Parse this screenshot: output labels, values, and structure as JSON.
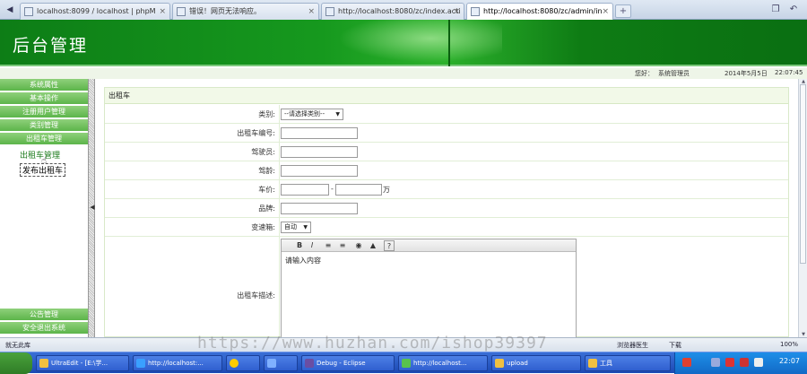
{
  "browser": {
    "tabs": [
      {
        "label": "localhost:8099 / localhost | phpM",
        "active": false
      },
      {
        "label": "错误！网页无法响应。",
        "active": false
      },
      {
        "label": "http://localhost:8080/zc/index.acti",
        "active": false
      },
      {
        "label": "http://localhost:8080/zc/admin/in",
        "active": true
      }
    ],
    "new_tab": "+",
    "close_glyph": "×"
  },
  "header": {
    "title": "后台管理"
  },
  "status_line": {
    "greeting": "您好：",
    "user": "系统管理员",
    "date": "2014年5月5日",
    "time": "22:07:45"
  },
  "sidebar": {
    "menus": [
      {
        "label": "系统属性"
      },
      {
        "label": "基本操作"
      },
      {
        "label": "注册用户管理"
      },
      {
        "label": "类别管理"
      },
      {
        "label": "出租车管理"
      }
    ],
    "submenus": [
      {
        "label": "出租车管理"
      },
      {
        "label": "发布出租车"
      }
    ],
    "bottom_menus": [
      {
        "label": "公告管理"
      },
      {
        "label": "安全退出系统"
      }
    ]
  },
  "form": {
    "caption": "出租车",
    "category_label": "类别:",
    "category_select": "--请选择类别--",
    "number_label": "出租车编号:",
    "driver_label": "驾驶员:",
    "age_label": "驾龄:",
    "price_label": "车价:",
    "price_sep": "-",
    "price_unit": "万",
    "brand_label": "品牌:",
    "transmission_label": "变速箱:",
    "transmission_select": "自动",
    "desc_label": "出租车描述:",
    "editor_placeholder": "请输入内容",
    "toolbar": [
      "B",
      "I",
      "≡",
      "≡",
      "◉",
      "▲",
      "?"
    ]
  },
  "browser_status": {
    "left": "就无此库",
    "zoom": "100%",
    "tools": "浏览器医生",
    "download": "下载"
  },
  "watermark": "https://www.huzhan.com/ishop39397",
  "taskbar": {
    "tasks": [
      {
        "label": "UltraEdit - [E:\\学..."
      },
      {
        "label": "http://localhost:..."
      },
      {
        "label": ""
      },
      {
        "label": ""
      },
      {
        "label": "Debug - Eclipse"
      },
      {
        "label": "http://localhost..."
      },
      {
        "label": "upload"
      },
      {
        "label": "工具"
      }
    ],
    "clock": "22:07"
  },
  "colors": {
    "header_green": "#16991e",
    "menu_green": "#5cb54a",
    "taskbar_blue": "#245edb"
  }
}
